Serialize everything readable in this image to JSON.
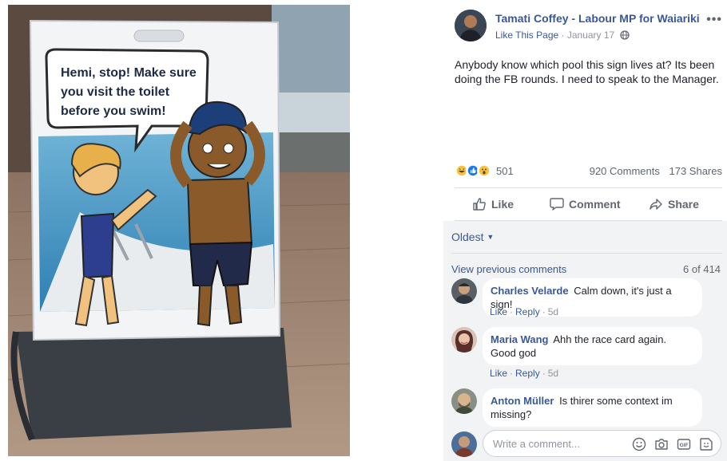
{
  "photo": {
    "speech_bubble": [
      "Hemi, stop! Make sure",
      "you visit the toilet",
      "before you swim!"
    ]
  },
  "post": {
    "author": "Tamati Coffey - Labour MP for Waiariki",
    "like_page": "Like This Page",
    "date": "January 17",
    "text": "Anybody know which pool this sign lives at? Its been doing the FB rounds. I need to speak to the Manager.",
    "reaction_count": "501",
    "comments_count": "920 Comments",
    "shares_count": "173 Shares",
    "actions": {
      "like": "Like",
      "comment": "Comment",
      "share": "Share"
    }
  },
  "comments": {
    "order": "Oldest",
    "view_previous": "View previous comments",
    "page_count": "6 of 414",
    "items": [
      {
        "name": "Charles Velarde",
        "text": "Calm down, it's just a sign!",
        "like": "Like",
        "reply": "Reply",
        "time": "5d"
      },
      {
        "name": "Maria Wang",
        "text": "Ahh the race card again. Good god",
        "like": "Like",
        "reply": "Reply",
        "time": "5d"
      },
      {
        "name": "Anton Müller",
        "text": "Is thirer some context im missing?"
      }
    ],
    "compose_placeholder": "Write a comment..."
  },
  "colors": {
    "link": "#385898",
    "muted": "#90949c",
    "comments_bg": "#f2f3f5"
  }
}
